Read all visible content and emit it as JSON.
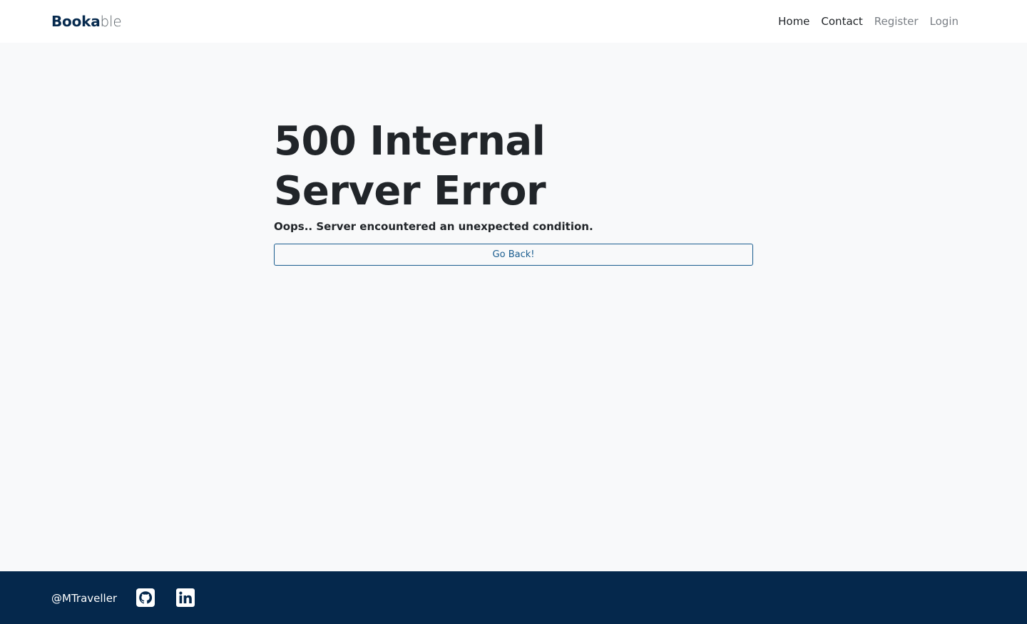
{
  "navbar": {
    "brand_strong": "Booka",
    "brand_light": "ble",
    "links": {
      "home": "Home",
      "contact": "Contact",
      "register": "Register",
      "login": "Login"
    }
  },
  "error": {
    "title": "500 Internal Server Error",
    "subtitle": "Oops.. Server encountered an unexpected condition.",
    "button_label": "Go Back!"
  },
  "footer": {
    "handle": "@MTraveller",
    "icons": [
      "github-icon",
      "linkedin-icon"
    ]
  },
  "colors": {
    "brand_navy": "#062a4e",
    "footer_bg": "#05284c",
    "page_bg": "#f8f9fa",
    "button_outline": "#1a5d8f"
  }
}
